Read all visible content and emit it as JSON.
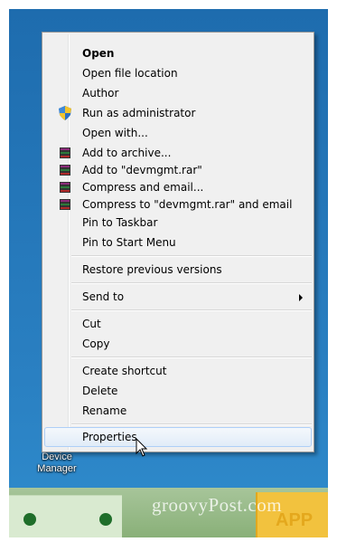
{
  "menu": {
    "items": [
      {
        "label": "Open",
        "bold": true
      },
      {
        "label": "Open file location"
      },
      {
        "label": "Author"
      },
      {
        "label": "Run as administrator",
        "icon": "uac-shield-icon"
      },
      {
        "label": "Open with..."
      },
      {
        "label": "Add to archive...",
        "icon": "winrar-icon"
      },
      {
        "label": "Add to \"devmgmt.rar\"",
        "icon": "winrar-icon"
      },
      {
        "label": "Compress and email...",
        "icon": "winrar-icon"
      },
      {
        "label": "Compress to \"devmgmt.rar\" and email",
        "icon": "winrar-icon"
      },
      {
        "label": "Pin to Taskbar"
      },
      {
        "label": "Pin to Start Menu"
      },
      {
        "label": "Restore previous versions"
      },
      {
        "label": "Send to",
        "submenu": true
      },
      {
        "label": "Cut"
      },
      {
        "label": "Copy"
      },
      {
        "label": "Create shortcut"
      },
      {
        "label": "Delete"
      },
      {
        "label": "Rename"
      },
      {
        "label": "Properties",
        "highlighted": true
      }
    ]
  },
  "desktop": {
    "icon_label_line1": "Device",
    "icon_label_line2": "Manager",
    "watermark": "groovyPost.com",
    "banner_text": "APP"
  },
  "colors": {
    "desktop_bg": "#2476b8",
    "menu_bg": "#f0f0f0",
    "highlight_border": "#aecff7"
  }
}
